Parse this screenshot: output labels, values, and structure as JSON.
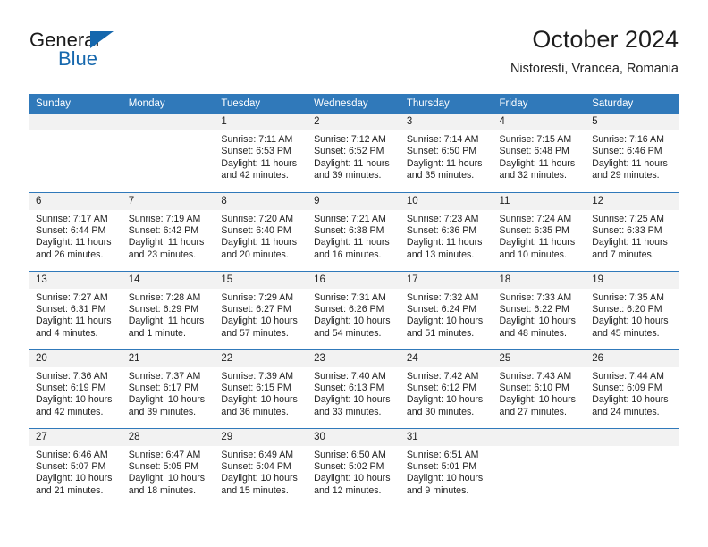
{
  "brand": {
    "name_part1": "General",
    "name_part2": "Blue",
    "accent_color": "#1567ad"
  },
  "header": {
    "title": "October 2024",
    "subtitle": "Nistoresti, Vrancea, Romania"
  },
  "theme": {
    "header_blue": "#3079ba",
    "daynum_bg": "#f2f2f2",
    "text": "#222222"
  },
  "weekday_headers": [
    "Sunday",
    "Monday",
    "Tuesday",
    "Wednesday",
    "Thursday",
    "Friday",
    "Saturday"
  ],
  "labels": {
    "sunrise_prefix": "Sunrise:",
    "sunset_prefix": "Sunset:",
    "daylight_prefix": "Daylight:"
  },
  "weeks": [
    [
      {
        "day": "",
        "lines": []
      },
      {
        "day": "",
        "lines": []
      },
      {
        "day": "1",
        "lines": [
          "Sunrise: 7:11 AM",
          "Sunset: 6:53 PM",
          "Daylight: 11 hours",
          "and 42 minutes."
        ]
      },
      {
        "day": "2",
        "lines": [
          "Sunrise: 7:12 AM",
          "Sunset: 6:52 PM",
          "Daylight: 11 hours",
          "and 39 minutes."
        ]
      },
      {
        "day": "3",
        "lines": [
          "Sunrise: 7:14 AM",
          "Sunset: 6:50 PM",
          "Daylight: 11 hours",
          "and 35 minutes."
        ]
      },
      {
        "day": "4",
        "lines": [
          "Sunrise: 7:15 AM",
          "Sunset: 6:48 PM",
          "Daylight: 11 hours",
          "and 32 minutes."
        ]
      },
      {
        "day": "5",
        "lines": [
          "Sunrise: 7:16 AM",
          "Sunset: 6:46 PM",
          "Daylight: 11 hours",
          "and 29 minutes."
        ]
      }
    ],
    [
      {
        "day": "6",
        "lines": [
          "Sunrise: 7:17 AM",
          "Sunset: 6:44 PM",
          "Daylight: 11 hours",
          "and 26 minutes."
        ]
      },
      {
        "day": "7",
        "lines": [
          "Sunrise: 7:19 AM",
          "Sunset: 6:42 PM",
          "Daylight: 11 hours",
          "and 23 minutes."
        ]
      },
      {
        "day": "8",
        "lines": [
          "Sunrise: 7:20 AM",
          "Sunset: 6:40 PM",
          "Daylight: 11 hours",
          "and 20 minutes."
        ]
      },
      {
        "day": "9",
        "lines": [
          "Sunrise: 7:21 AM",
          "Sunset: 6:38 PM",
          "Daylight: 11 hours",
          "and 16 minutes."
        ]
      },
      {
        "day": "10",
        "lines": [
          "Sunrise: 7:23 AM",
          "Sunset: 6:36 PM",
          "Daylight: 11 hours",
          "and 13 minutes."
        ]
      },
      {
        "day": "11",
        "lines": [
          "Sunrise: 7:24 AM",
          "Sunset: 6:35 PM",
          "Daylight: 11 hours",
          "and 10 minutes."
        ]
      },
      {
        "day": "12",
        "lines": [
          "Sunrise: 7:25 AM",
          "Sunset: 6:33 PM",
          "Daylight: 11 hours",
          "and 7 minutes."
        ]
      }
    ],
    [
      {
        "day": "13",
        "lines": [
          "Sunrise: 7:27 AM",
          "Sunset: 6:31 PM",
          "Daylight: 11 hours",
          "and 4 minutes."
        ]
      },
      {
        "day": "14",
        "lines": [
          "Sunrise: 7:28 AM",
          "Sunset: 6:29 PM",
          "Daylight: 11 hours",
          "and 1 minute."
        ]
      },
      {
        "day": "15",
        "lines": [
          "Sunrise: 7:29 AM",
          "Sunset: 6:27 PM",
          "Daylight: 10 hours",
          "and 57 minutes."
        ]
      },
      {
        "day": "16",
        "lines": [
          "Sunrise: 7:31 AM",
          "Sunset: 6:26 PM",
          "Daylight: 10 hours",
          "and 54 minutes."
        ]
      },
      {
        "day": "17",
        "lines": [
          "Sunrise: 7:32 AM",
          "Sunset: 6:24 PM",
          "Daylight: 10 hours",
          "and 51 minutes."
        ]
      },
      {
        "day": "18",
        "lines": [
          "Sunrise: 7:33 AM",
          "Sunset: 6:22 PM",
          "Daylight: 10 hours",
          "and 48 minutes."
        ]
      },
      {
        "day": "19",
        "lines": [
          "Sunrise: 7:35 AM",
          "Sunset: 6:20 PM",
          "Daylight: 10 hours",
          "and 45 minutes."
        ]
      }
    ],
    [
      {
        "day": "20",
        "lines": [
          "Sunrise: 7:36 AM",
          "Sunset: 6:19 PM",
          "Daylight: 10 hours",
          "and 42 minutes."
        ]
      },
      {
        "day": "21",
        "lines": [
          "Sunrise: 7:37 AM",
          "Sunset: 6:17 PM",
          "Daylight: 10 hours",
          "and 39 minutes."
        ]
      },
      {
        "day": "22",
        "lines": [
          "Sunrise: 7:39 AM",
          "Sunset: 6:15 PM",
          "Daylight: 10 hours",
          "and 36 minutes."
        ]
      },
      {
        "day": "23",
        "lines": [
          "Sunrise: 7:40 AM",
          "Sunset: 6:13 PM",
          "Daylight: 10 hours",
          "and 33 minutes."
        ]
      },
      {
        "day": "24",
        "lines": [
          "Sunrise: 7:42 AM",
          "Sunset: 6:12 PM",
          "Daylight: 10 hours",
          "and 30 minutes."
        ]
      },
      {
        "day": "25",
        "lines": [
          "Sunrise: 7:43 AM",
          "Sunset: 6:10 PM",
          "Daylight: 10 hours",
          "and 27 minutes."
        ]
      },
      {
        "day": "26",
        "lines": [
          "Sunrise: 7:44 AM",
          "Sunset: 6:09 PM",
          "Daylight: 10 hours",
          "and 24 minutes."
        ]
      }
    ],
    [
      {
        "day": "27",
        "lines": [
          "Sunrise: 6:46 AM",
          "Sunset: 5:07 PM",
          "Daylight: 10 hours",
          "and 21 minutes."
        ]
      },
      {
        "day": "28",
        "lines": [
          "Sunrise: 6:47 AM",
          "Sunset: 5:05 PM",
          "Daylight: 10 hours",
          "and 18 minutes."
        ]
      },
      {
        "day": "29",
        "lines": [
          "Sunrise: 6:49 AM",
          "Sunset: 5:04 PM",
          "Daylight: 10 hours",
          "and 15 minutes."
        ]
      },
      {
        "day": "30",
        "lines": [
          "Sunrise: 6:50 AM",
          "Sunset: 5:02 PM",
          "Daylight: 10 hours",
          "and 12 minutes."
        ]
      },
      {
        "day": "31",
        "lines": [
          "Sunrise: 6:51 AM",
          "Sunset: 5:01 PM",
          "Daylight: 10 hours",
          "and 9 minutes."
        ]
      },
      {
        "day": "",
        "lines": []
      },
      {
        "day": "",
        "lines": []
      }
    ]
  ]
}
